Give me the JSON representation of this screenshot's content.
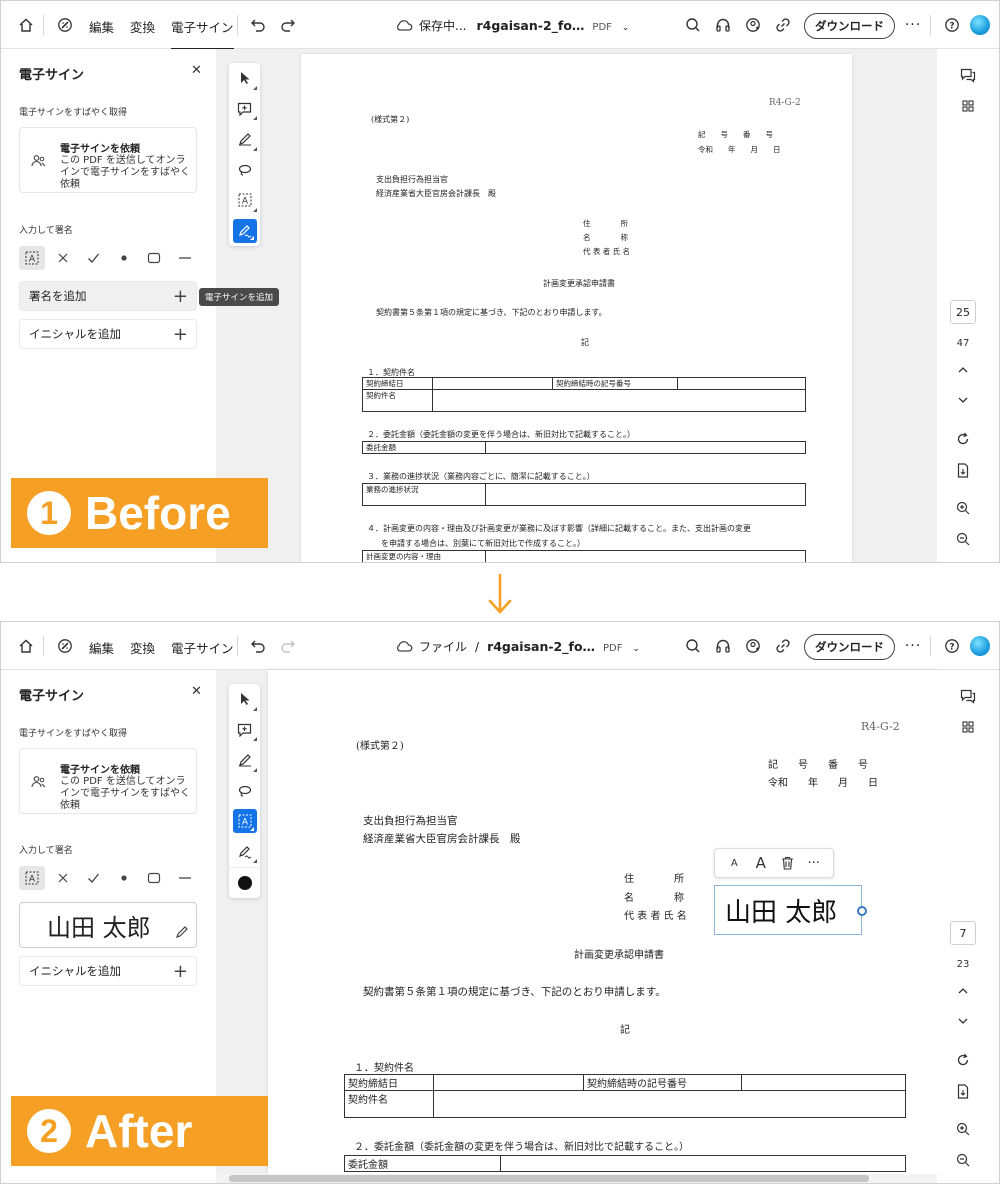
{
  "before": {
    "toolbar": {
      "menu": [
        "編集",
        "変換",
        "電子サイン"
      ],
      "file_status": "保存中...",
      "file_name": "r4gaisan-2_fo…",
      "file_type": "PDF",
      "download_label": "ダウンロード"
    },
    "sidebar": {
      "title": "電子サイン",
      "quick_heading": "電子サインをすばやく取得",
      "request_title": "電子サインを依頼",
      "request_desc": "この PDF を送信してオンラインで電子サインをすばやく依頼",
      "type_heading": "入力して署名",
      "add_signature": "署名を追加",
      "add_initials": "イニシャルを追加",
      "tooltip": "電子サインを追加"
    },
    "page_nav": {
      "current": "25",
      "total": "47"
    },
    "badge": {
      "number": "1",
      "label": "Before"
    }
  },
  "after": {
    "toolbar": {
      "menu": [
        "編集",
        "変換",
        "電子サイン"
      ],
      "breadcrumb_root": "ファイル",
      "breadcrumb_sep": "/",
      "file_name": "r4gaisan-2_fo…",
      "file_type": "PDF",
      "download_label": "ダウンロード"
    },
    "sidebar": {
      "title": "電子サイン",
      "quick_heading": "電子サインをすばやく取得",
      "request_title": "電子サインを依頼",
      "request_desc": "この PDF を送信してオンラインで電子サインをすばやく依頼",
      "type_heading": "入力して署名",
      "signature_value": "山田 太郎",
      "add_initials": "イニシャルを追加"
    },
    "signature_field": {
      "value": "山田 太郎"
    },
    "float_toolbar": {
      "small_a": "A",
      "large_a": "A",
      "more": "···"
    },
    "page_nav": {
      "current": "7",
      "total": "23"
    },
    "badge": {
      "number": "2",
      "label": "After"
    }
  },
  "document": {
    "form_code": "R4-G-2",
    "form_no": "(様式第２)",
    "rec_label": "記　　号　　番　　号",
    "date_label": "令和　　年　　月　　日",
    "addressee_1": "支出負担行為担当官",
    "addressee_2": "経済産業省大臣官房会計課長　殿",
    "addr_label": "住　　　　所",
    "name_label": "名　　　　称",
    "rep_label": "代 表 者 氏 名",
    "doc_title": "計画変更承認申請書",
    "intro": "契約書第５条第１項の規定に基づき、下記のとおり申請します。",
    "ki": "記",
    "sec1": "１．契約件名",
    "sec1_cells": [
      "契約締結日",
      "契約締結時の記号番号",
      "契約件名"
    ],
    "sec2": "２．委託金額（委託金額の変更を伴う場合は、新旧対比で記載すること。）",
    "sec2_cell": "委託金額",
    "sec3": "３．業務の進捗状況（業務内容ごとに、簡潔に記載すること。）",
    "sec3_cell": "業務の進捗状況",
    "sec4_line1": "４．計画変更の内容・理由及び計画変更が業務に及ぼす影響（詳細に記載すること。また、支出計画の変更",
    "sec4_line2": "を申請する場合は、別葉にて新旧対比で作成すること。）",
    "sec4_cell": "計画変更の内容・理由"
  }
}
